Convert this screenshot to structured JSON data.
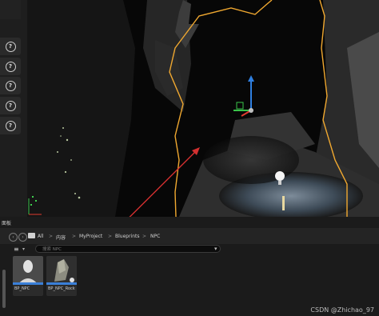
{
  "side_panel": {
    "help_button_label": "?"
  },
  "content_browser": {
    "tab_label": "面板",
    "breadcrumb": [
      "All",
      "内容",
      "MyProject",
      "Blueprints",
      "NPC"
    ],
    "breadcrumb_separator": ">",
    "search_placeholder": "搜索 NPC",
    "assets": [
      {
        "label": "BP_NPC"
      },
      {
        "label": "BP_NPC_Rock"
      }
    ]
  },
  "watermark": "CSDN @Zhichao_97",
  "colors": {
    "selection_outline": "#f0a830",
    "arrow": "#d43030",
    "gizmo_z": "#2f7fe0",
    "gizmo_x": "#e03a30",
    "gizmo_y": "#3ac44a"
  }
}
